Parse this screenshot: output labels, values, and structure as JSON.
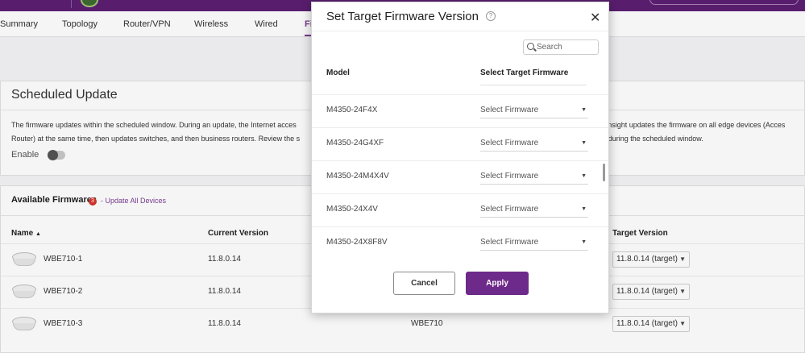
{
  "colors": {
    "brand": "#5c1f72",
    "accent": "#7a3d93",
    "badge": "#d4362b",
    "apply_button": "#6e2a8a"
  },
  "tabs": [
    {
      "label": "Summary"
    },
    {
      "label": "Topology"
    },
    {
      "label": "Router/VPN"
    },
    {
      "label": "Wireless"
    },
    {
      "label": "Wired"
    },
    {
      "label": "Fi"
    }
  ],
  "scheduled": {
    "title": "Scheduled Update",
    "desc_line1_left": "The firmware updates within the scheduled window. During an update, the Internet acces",
    "desc_line1_right": "sk, Insight updates the firmware on all edge devices (Acces",
    "desc_line2_left": "Router) at the same time, then updates switches, and then business routers. Review the s",
    "desc_line2_right": "ed during the scheduled window.",
    "enable_label": "Enable"
  },
  "firmwares": {
    "title": "Available Firmwares",
    "badge_count": "3",
    "update_all": "- Update All Devices",
    "columns": {
      "name": "Name",
      "current": "Current Version",
      "target": "Target Version"
    },
    "rows": [
      {
        "name": "WBE710-1",
        "current": "11.8.0.14",
        "model": "",
        "target": "11.8.0.14 (target)"
      },
      {
        "name": "WBE710-2",
        "current": "11.8.0.14",
        "model": "",
        "target": "11.8.0.14 (target)"
      },
      {
        "name": "WBE710-3",
        "current": "11.8.0.14",
        "model": "WBE710",
        "target": "11.8.0.14 (target)"
      }
    ]
  },
  "modal": {
    "title": "Set Target Firmware Version",
    "search_placeholder": "Search",
    "col_model": "Model",
    "col_target": "Select Target Firmware",
    "rows": [
      {
        "model": "M4350-24F4X",
        "select": "Select Firmware"
      },
      {
        "model": "M4350-24G4XF",
        "select": "Select Firmware"
      },
      {
        "model": "M4350-24M4X4V",
        "select": "Select Firmware"
      },
      {
        "model": "M4350-24X4V",
        "select": "Select Firmware"
      },
      {
        "model": "M4350-24X8F8V",
        "select": "Select Firmware"
      }
    ],
    "cancel": "Cancel",
    "apply": "Apply"
  }
}
